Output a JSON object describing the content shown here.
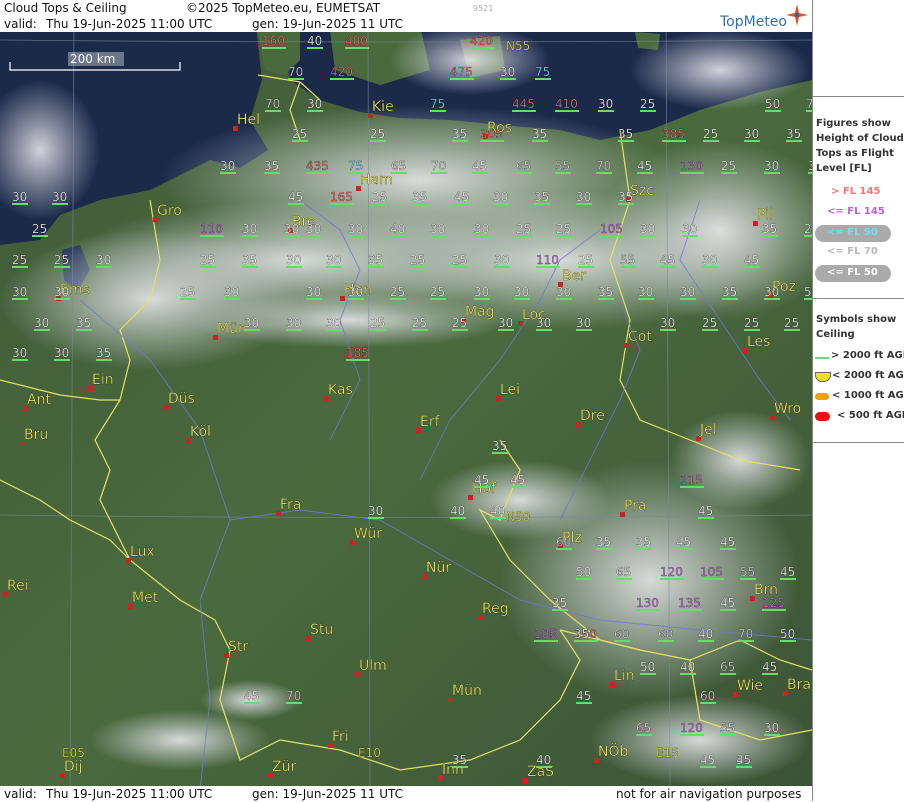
{
  "header": {
    "title": "Cloud Tops & Ceiling",
    "copyright": "©2025 TopMeteo.eu, EUMETSAT",
    "valid_label": "valid:",
    "valid_time": "Thu  19-Jun-2025  11:00 UTC",
    "gen_time": "gen: 19-Jun-2025 11 UTC",
    "code": "9521",
    "logo": "TopMeteo"
  },
  "footer": {
    "valid_label": "valid:",
    "valid_time": "Thu  19-Jun-2025  11:00 UTC",
    "gen_time": "gen: 19-Jun-2025 11 UTC",
    "disclaimer": "not for air navigation purposes"
  },
  "scale": {
    "label": "200 km"
  },
  "legend": {
    "tops_title": [
      "Figures show",
      "Height of Cloud",
      "Tops as Flight",
      "Level  [FL]"
    ],
    "tops": [
      {
        "label": "> FL 145",
        "color": "#ff7070"
      },
      {
        "label": "<= FL 145",
        "color": "#d070e0"
      },
      {
        "label": "<= FL 90",
        "color": "#6fe0f0"
      },
      {
        "label": "<= FL 70",
        "color": "#dddddd"
      },
      {
        "label": "<= FL 50",
        "color": "#ffffff"
      }
    ],
    "ceiling_title": [
      "Symbols show",
      "Ceiling"
    ],
    "ceiling": [
      {
        "label": "> 2000 ft AGL",
        "color": "#66dd66"
      },
      {
        "label": "< 2000 ft AGL",
        "color": "#f0e020"
      },
      {
        "label": "< 1000 ft AGL",
        "color": "#f0a000"
      },
      {
        "label": "< 500 ft AGL",
        "color": "#ee1010"
      }
    ]
  },
  "cities": [
    "Hel",
    "Kie",
    "Ros",
    "Ham",
    "Gro",
    "Bre",
    "Szc",
    "Pil",
    "Ber",
    "Ems",
    "Han",
    "Mag",
    "Loc",
    "Poz",
    "Mün",
    "Cot",
    "Les",
    "Ein",
    "Ant",
    "Kas",
    "Lei",
    "Düs",
    "Wro",
    "Bru",
    "Köl",
    "Erf",
    "Dre",
    "Jel",
    "Hof",
    "Fra",
    "Pra",
    "Lux",
    "Wür",
    "Plz",
    "Rei",
    "Nür",
    "Met",
    "Reg",
    "Brn",
    "Stu",
    "Str",
    "Lin",
    "Ulm",
    "Mün",
    "Wie",
    "Bra",
    "Fri",
    "Zür",
    "Inn",
    "ZaS",
    "NÖb",
    "Dij"
  ],
  "grid_labels": [
    "N55",
    "N50",
    "E05",
    "E10",
    "E15"
  ],
  "flight_levels": [
    "160",
    "40",
    "400",
    "420",
    "N55",
    "70",
    "420",
    "475",
    "30",
    "75",
    "70",
    "30",
    "75",
    "445",
    "410",
    "30",
    "25",
    "50",
    "70",
    "25",
    "25",
    "Kie",
    "35",
    "305",
    "35",
    "Ros",
    "35",
    "385",
    "25",
    "30",
    "35",
    "30",
    "35",
    "435",
    "75",
    "65",
    "70",
    "45",
    "65",
    "55",
    "70",
    "45",
    "130",
    "25",
    "30",
    "30",
    "30",
    "30",
    "45",
    "165",
    "25",
    "35",
    "45",
    "30",
    "35",
    "30",
    "35",
    "Szc",
    "25",
    "110",
    "30",
    "30",
    "30",
    "30",
    "40",
    "30",
    "30",
    "25",
    "25",
    "105",
    "30",
    "30",
    "Pil",
    "35",
    "25",
    "25",
    "25",
    "30",
    "25",
    "35",
    "30",
    "30",
    "35",
    "25",
    "25",
    "30",
    "110",
    "25",
    "55",
    "45",
    "30",
    "45",
    "Ems",
    "30",
    "30",
    "25",
    "30",
    "Han",
    "30",
    "30",
    "25",
    "25",
    "30",
    "30",
    "30",
    "35",
    "30",
    "30",
    "35",
    "30",
    "50",
    "30",
    "35",
    "30",
    "30",
    "30",
    "25",
    "25",
    "25",
    "30",
    "30",
    "30",
    "30",
    "25",
    "25",
    "25",
    "30",
    "30",
    "35",
    "185",
    "35",
    "30",
    "45",
    "45",
    "115",
    "40",
    "40",
    "45",
    "60",
    "35",
    "35",
    "45",
    "45",
    "50",
    "65",
    "120",
    "105",
    "55",
    "45",
    "35",
    "130",
    "135",
    "45",
    "125",
    "105",
    "160",
    "60",
    "60",
    "40",
    "70",
    "50",
    "50",
    "40",
    "65",
    "45",
    "45",
    "70",
    "45",
    "60",
    "65",
    "120",
    "55",
    "30",
    "35",
    "45",
    "35",
    "45",
    "40",
    "35",
    "Wro"
  ]
}
